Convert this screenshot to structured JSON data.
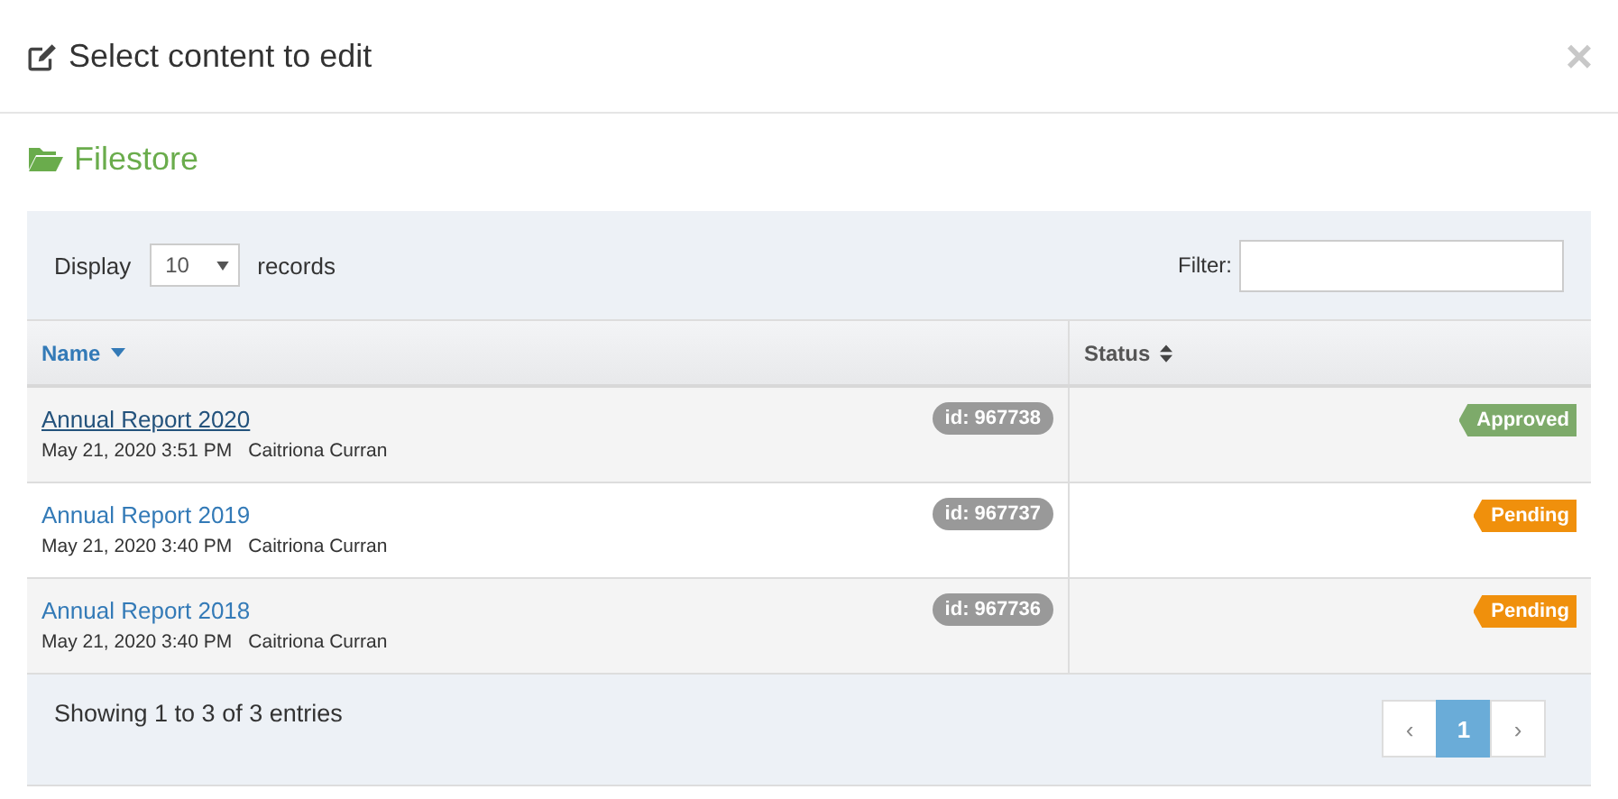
{
  "dialog": {
    "title": "Select content to edit",
    "close": "×"
  },
  "section": {
    "title": "Filestore"
  },
  "toolbar": {
    "display_label": "Display",
    "page_size": "10",
    "records_label": "records",
    "filter_label": "Filter:"
  },
  "table": {
    "columns": [
      {
        "label": "Name",
        "sorted": true
      },
      {
        "label": "Status",
        "sorted": false
      }
    ],
    "rows": [
      {
        "name": "Annual Report 2020",
        "hovered": true,
        "date": "May 21, 2020 3:51 PM",
        "author": "Caitriona Curran",
        "id": "id: 967738",
        "status": "Approved",
        "color": "#7daa6a"
      },
      {
        "name": "Annual Report 2019",
        "hovered": false,
        "date": "May 21, 2020 3:40 PM",
        "author": "Caitriona Curran",
        "id": "id: 967737",
        "status": "Pending",
        "color": "#f0900c"
      },
      {
        "name": "Annual Report 2018",
        "hovered": false,
        "date": "May 21, 2020 3:40 PM",
        "author": "Caitriona Curran",
        "id": "id: 967736",
        "status": "Pending",
        "color": "#f0900c"
      }
    ]
  },
  "footer": {
    "info": "Showing 1 to 3 of 3 entries",
    "pager": [
      {
        "label": "‹",
        "kind": "prev",
        "selected": false
      },
      {
        "label": "1",
        "kind": "page",
        "selected": true
      },
      {
        "label": "›",
        "kind": "next",
        "selected": false
      }
    ]
  }
}
